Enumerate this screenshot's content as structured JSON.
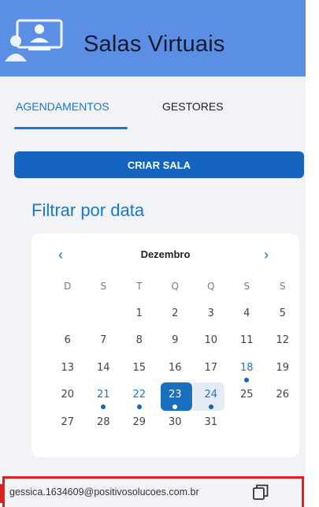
{
  "app": {
    "title": "Salas Virtuais",
    "logo_icon": "classroom-people-icon"
  },
  "tabs": [
    {
      "label": "AGENDAMENTOS",
      "active": true
    },
    {
      "label": "GESTORES",
      "active": false
    }
  ],
  "actions": {
    "create_room": "CRIAR SALA"
  },
  "filter": {
    "title": "Filtrar por data"
  },
  "calendar": {
    "month": "Dezembro",
    "prev_icon": "chevron-left-icon",
    "next_icon": "chevron-right-icon",
    "weekdays": [
      "D",
      "S",
      "T",
      "Q",
      "Q",
      "S",
      "S"
    ],
    "first_weekday_index": 2,
    "days": [
      "1",
      "2",
      "3",
      "4",
      "5",
      "6",
      "7",
      "8",
      "9",
      "10",
      "11",
      "12",
      "13",
      "14",
      "15",
      "16",
      "17",
      "18",
      "19",
      "20",
      "21",
      "22",
      "23",
      "24",
      "25",
      "26",
      "27",
      "28",
      "29",
      "30",
      "31"
    ],
    "event_days": [
      "18",
      "21",
      "22",
      "23",
      "24"
    ],
    "selected_day": "23",
    "today": "24"
  },
  "user": {
    "email": "gessica.1634609@positivosolucoes.com.br",
    "copy_icon": "copy-icon"
  },
  "colors": {
    "header": "#5b8fe6",
    "accent": "#1976d2",
    "button": "#1565c0",
    "highlight": "#e02020"
  }
}
